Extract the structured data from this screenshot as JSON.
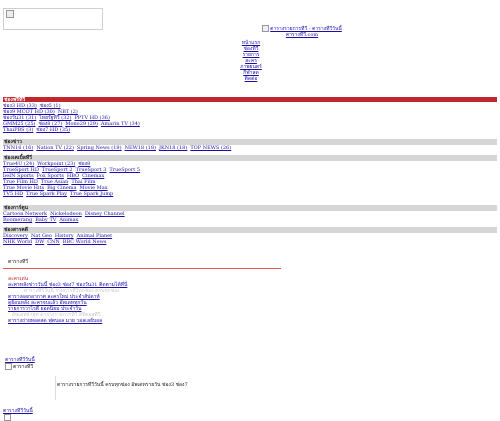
{
  "banner": {
    "line1": "ตารางรายการทีวี - ตารางทีวีวันนี้",
    "line2": "ตารางทีวี.com"
  },
  "topnav": [
    "หน้าแรก",
    "ช่องทีวี",
    "รายการ",
    "ละคร",
    "ภาพยนตร์",
    "กีฬาสด",
    "ติดต่อ"
  ],
  "sections": [
    {
      "heading": "ช่องฟรีทีวี",
      "rows": [
        [
          "ช่อง3 HD (33)",
          "ช่อง5 (1)",
          "ช่อง7 HD (35)"
        ],
        [
          "ช่อง9 MCOT HD (30)",
          "NBT (2)",
          "ThaiPBS (3)"
        ],
        [
          "ช่องวัน31 (31)",
          "ไทยรัฐทีวี (32)",
          "PPTV HD (36)"
        ],
        [
          "GMM25 (25)",
          "ช่อง8 (27)",
          "Mono29 (29)",
          "Amarin TV (34)"
        ]
      ]
    },
    {
      "heading": "ช่องข่าว",
      "rows": [
        [
          "TNN16 (16)",
          "Nation TV (22)",
          "Spring News (19)",
          "NEW18 (18)",
          "JKN18 (18)",
          "TOP NEWS (26)"
        ]
      ]
    },
    {
      "heading": "ช่องเคเบิ้ลทีวี",
      "rows": [
        [
          "True4U (24)",
          "Workpoint (23)",
          "ช่อง8"
        ],
        [
          "TrueSport HD",
          "TrueSport 2",
          "TrueSport 3",
          "TrueSport 5"
        ],
        [
          "beIN Sports",
          "Fox Sports",
          "HBO",
          "Cinemax"
        ],
        [
          "True Film HD",
          "True Asian",
          "Thai Film"
        ],
        [
          "True Movie Hits",
          "Big Cinema",
          "Movie Max"
        ],
        [
          "TV5 HD",
          "True Spark Play",
          "True Spark Jump"
        ]
      ]
    },
    {
      "heading": "ช่องการ์ตูน",
      "rows": [
        [
          "Cartoon Network",
          "Nickelodeon",
          "Disney Channel"
        ],
        [
          "Boomerang",
          "Baby TV",
          "Animax"
        ]
      ]
    },
    {
      "heading": "ช่องสารคดี",
      "rows": [
        [
          "Discovery",
          "Nat Geo",
          "History",
          "Animal Planet"
        ],
        [
          "NHK World",
          "DW",
          "CNN",
          "BBC World News"
        ]
      ]
    }
  ],
  "mid": {
    "title": "ตารางทีวี",
    "feature_title": "ละครเด่น",
    "feature_lines": [
      "ละครหลังข่าววันนี้ ช่อง3 ช่อง7 ช่องวัน31 ติดตามได้ที่นี่",
      "ตารางออกอากาศ ละครใหม่ ประจำสัปดาห์",
      "ดูย้อนหลัง ละครจบแล้ว อัพเดททุกวัน",
      "รายการวาไรตี้ ยอดนิยม ประจำวัน",
      "ตารางถ่ายทอดสด ฟุตบอล มวย วอลเลย์บอล"
    ],
    "faint_lines": [
      "ตารางทีวีวันนี้ รายการทีวีทุกช่อง ครบทุกช่อง",
      "อัพเดทล่าสุด ตารางรายการทีวี ดิจิตอลทีวี"
    ]
  },
  "list": {
    "title": "ตารางทีวีวันนี้",
    "caption": "ตารางทีวี",
    "lines": [
      "",
      "ตารางรายการทีวีวันนี้ ครบทุกช่อง อัพเดทรายวัน ช่อง3 ช่อง7",
      ""
    ]
  },
  "pager": {
    "label": "ตารางทีวีวันนี้"
  }
}
